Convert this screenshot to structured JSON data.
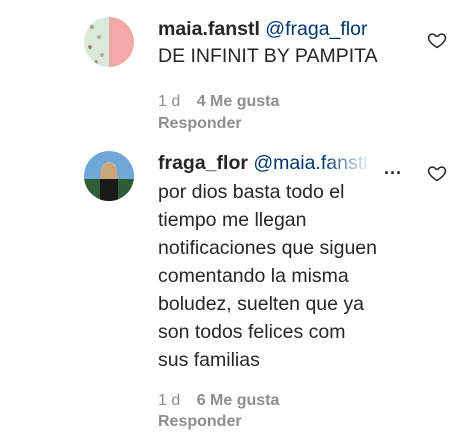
{
  "comments": [
    {
      "username": "maia.fanstl",
      "mention": "@fraga_flor",
      "lines": [
        "DE INFINIT BY PAMPITA"
      ],
      "time": "1 d",
      "likes": "4 Me gusta",
      "reply": "Responder",
      "avatar_colors": [
        "#f4a6a6",
        "#cfe8d6",
        "#e8c7b5"
      ]
    },
    {
      "username": "fraga_flor",
      "mention": "@maia.fanstl",
      "lines": [
        "por dios basta todo el",
        "tiempo me llegan",
        "notificaciones que siguen",
        "comentando la misma",
        "boludez, suelten que ya",
        "son todos felices com",
        "sus familias"
      ],
      "time": "1 d",
      "likes": "6 Me gusta",
      "reply": "Responder",
      "more": "...",
      "avatar_colors": [
        "#4a90c8",
        "#d9c2a3",
        "#1f3d2a"
      ]
    }
  ],
  "icons": {
    "like": "heart-outline-icon",
    "more": "more-options-icon"
  }
}
